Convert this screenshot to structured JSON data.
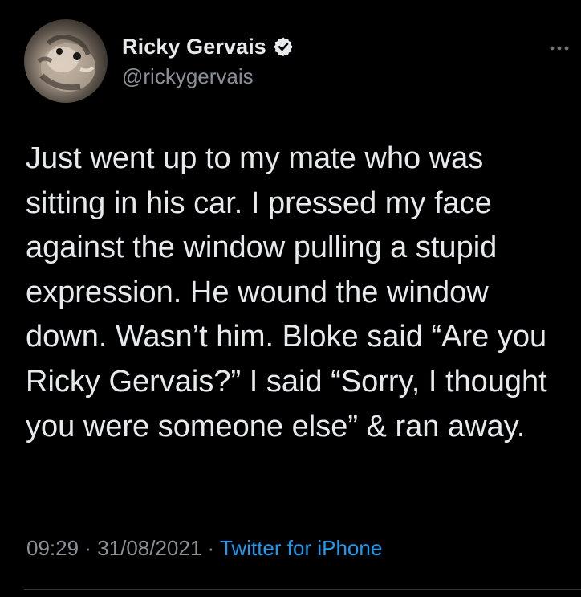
{
  "tweet": {
    "author": {
      "display_name": "Ricky Gervais",
      "handle": "@rickygervais",
      "verified": true,
      "avatar": "cat-photo-avatar"
    },
    "text": "Just went up to my mate who was sitting in his car. I pressed my face against the window pulling a stupid expression. He wound the window down. Wasn’t him. Bloke said “Are you Ricky Gervais?” I said “Sorry, I thought you were someone else” & ran away.",
    "time": "09:29",
    "separator": " · ",
    "date": "31/08/2021",
    "source": "Twitter for iPhone"
  },
  "icons": {
    "verified": "verified-badge-icon",
    "more": "more-options-icon"
  },
  "colors": {
    "background": "#000000",
    "text": "#e7e9ea",
    "secondary": "#8b9097",
    "link": "#1d9bf0"
  }
}
